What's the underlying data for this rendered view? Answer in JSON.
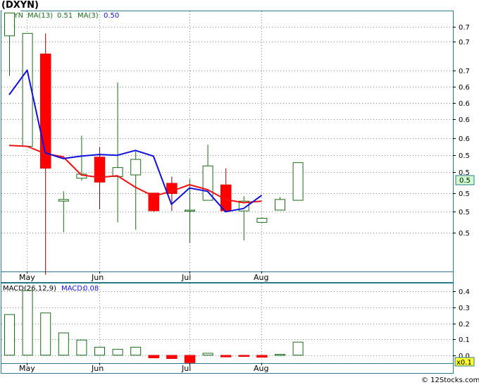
{
  "title": "(DXYN)",
  "legend": {
    "ticker": "DXYN",
    "ma13_label": "MA(13)",
    "ma13_value": "0.51",
    "ma3_label": "MA(3)",
    "ma3_value": "0.50",
    "macd_params": "MACD(26,12,9)",
    "macd_label": "MACD:",
    "macd_value": "0.08"
  },
  "credit": "© 12Stocks.com",
  "colors": {
    "up": "#1a6b1a",
    "down": "#ff0000",
    "ma13": "#ee1111",
    "ma3": "#1111dd",
    "frame": "#2a7a8a",
    "price_tag": "#cfffcf",
    "macd_tag": "#ffff33"
  },
  "chart_data": [
    {
      "type": "candlestick",
      "name": "price",
      "x_months": [
        "May",
        "Jun",
        "Jul",
        "Aug"
      ],
      "y_tick_labels": [
        "0.7",
        "0.7",
        "0.7",
        "0.6",
        "0.6",
        "0.6",
        "0.6",
        "0.5",
        "0.5",
        "0.5",
        "0.5",
        "0.5"
      ],
      "ylim": [
        0.474,
        0.792
      ],
      "last_price_label": "0.5",
      "candles": [
        {
          "open": 0.762,
          "high": 0.79,
          "low": 0.713,
          "close": 0.79
        },
        {
          "open": 0.627,
          "high": 0.765,
          "low": 0.627,
          "close": 0.765
        },
        {
          "open": 0.74,
          "high": 0.765,
          "low": 0.47,
          "close": 0.6
        },
        {
          "open": 0.56,
          "high": 0.572,
          "low": 0.522,
          "close": 0.562
        },
        {
          "open": 0.588,
          "high": 0.64,
          "low": 0.585,
          "close": 0.593
        },
        {
          "open": 0.614,
          "high": 0.626,
          "low": 0.55,
          "close": 0.583
        },
        {
          "open": 0.59,
          "high": 0.705,
          "low": 0.534,
          "close": 0.601
        },
        {
          "open": 0.592,
          "high": 0.622,
          "low": 0.525,
          "close": 0.611
        },
        {
          "open": 0.57,
          "high": 0.57,
          "low": 0.547,
          "close": 0.548
        },
        {
          "open": 0.582,
          "high": 0.59,
          "low": 0.548,
          "close": 0.569
        },
        {
          "open": 0.548,
          "high": 0.587,
          "low": 0.509,
          "close": 0.549
        },
        {
          "open": 0.561,
          "high": 0.629,
          "low": 0.561,
          "close": 0.603
        },
        {
          "open": 0.58,
          "high": 0.6,
          "low": 0.548,
          "close": 0.548
        },
        {
          "open": 0.548,
          "high": 0.566,
          "low": 0.512,
          "close": 0.56
        },
        {
          "open": 0.534,
          "high": 0.54,
          "low": 0.534,
          "close": 0.539
        },
        {
          "open": 0.549,
          "high": 0.565,
          "low": 0.549,
          "close": 0.562
        },
        {
          "open": 0.561,
          "high": 0.607,
          "low": 0.561,
          "close": 0.607
        }
      ],
      "ma13": [
        0.628,
        0.627,
        0.618,
        0.614,
        0.592,
        0.589,
        0.591,
        0.577,
        0.566,
        0.572,
        0.58,
        0.574,
        0.562,
        0.558,
        0.56
      ],
      "ma3": [
        0.69,
        0.72,
        0.619,
        0.612,
        0.615,
        0.617,
        0.616,
        0.622,
        0.615,
        0.556,
        0.576,
        0.572,
        0.547,
        0.551,
        0.567
      ]
    },
    {
      "type": "bar",
      "name": "MACD histogram",
      "y_tick_labels": [
        "0.4",
        "0.3",
        "0.2",
        "0.1",
        "0.0"
      ],
      "ylim": [
        -0.05,
        0.45
      ],
      "ylim_note": "x0.1",
      "values": [
        0.255,
        0.405,
        0.265,
        0.14,
        0.095,
        0.05,
        0.037,
        0.05,
        -0.018,
        -0.022,
        -0.048,
        0.012,
        -0.012,
        -0.008,
        -0.014,
        0.005,
        0.082
      ]
    }
  ]
}
